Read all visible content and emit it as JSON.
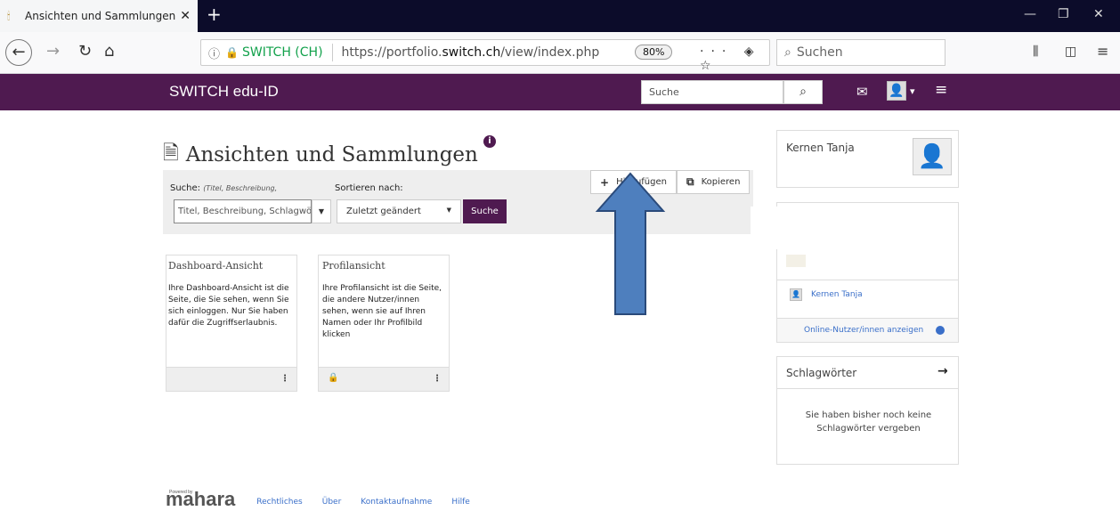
{
  "browser": {
    "tab_title": "Ansichten und Sammlungen - S",
    "tab_icon": "🕯",
    "new_tab": "+",
    "org_label": "SWITCH (CH)",
    "url_prefix": "https://portfolio.",
    "url_host": "switch.ch",
    "url_path": "/view/index.php",
    "zoom": "80%",
    "search_placeholder": "Suchen"
  },
  "header": {
    "brand": "SWITCH edu-ID",
    "search_placeholder": "Suche"
  },
  "page": {
    "title": "Ansichten und Sammlungen",
    "search_label": "Suche:",
    "search_hint": "(Titel, Beschreibung,",
    "search_value": "Titel, Beschreibung, Schlagwö",
    "sort_label": "Sortieren nach:",
    "sort_value": "Zuletzt geändert",
    "search_button": "Suche",
    "add_button": "Hinzufügen",
    "copy_button": "Kopieren"
  },
  "cards": [
    {
      "title": "Dashboard-Ansicht",
      "description": "Ihre Dashboard-Ansicht ist die Seite, die Sie sehen, wenn Sie sich einloggen. Nur Sie haben dafür die Zugriffserlaubnis."
    },
    {
      "title": "Profilansicht",
      "description": "Ihre Profilansicht ist die Seite, die andere Nutzer/innen sehen, wenn sie auf Ihren Namen oder Ihr Profilbild klicken"
    }
  ],
  "sidebar": {
    "profile_name": "Kernen Tanja",
    "online_user": "Kernen Tanja",
    "show_online": "Online-Nutzer/innen anzeigen",
    "tags_title": "Schlagwörter",
    "tags_empty": "Sie haben bisher noch keine Schlagwörter vergeben"
  },
  "footer": {
    "powered_by": "Powered by",
    "logo": "mahara",
    "links": [
      "Rechtliches",
      "Über",
      "Kontaktaufnahme",
      "Hilfe"
    ]
  },
  "colors": {
    "header_bg": "#4f1a50",
    "link": "#3a6fc9",
    "arrow_fill": "#4e7fbe",
    "secure_green": "#12a14b"
  }
}
